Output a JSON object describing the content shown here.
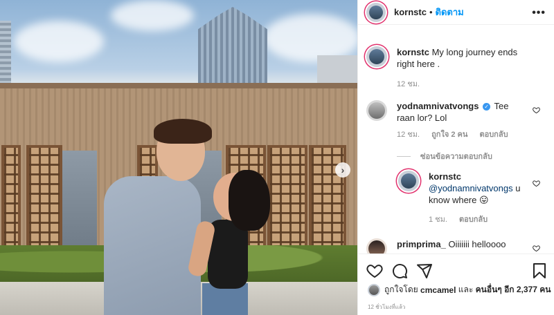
{
  "post": {
    "username": "kornstc",
    "separator": "•",
    "follow_label": "ติดตาม",
    "more_icon": "more-dots-icon"
  },
  "caption": {
    "username": "kornstc",
    "text": "My long journey ends right here .",
    "time": "12 ชม."
  },
  "comments": [
    {
      "username": "yodnamnivatvongs",
      "verified": true,
      "text": "Tee raan lor? Lol",
      "time": "12 ชม.",
      "likes": "ถูกใจ 2 คน",
      "reply_label": "ตอบกลับ",
      "hide_replies_label": "ซ่อนข้อความตอบกลับ",
      "replies": [
        {
          "username": "kornstc",
          "mention": "@yodnamnivatvongs",
          "text": "u know where",
          "emoji": "😛",
          "time": "1 ชม.",
          "reply_label": "ตอบกลับ"
        }
      ]
    },
    {
      "username": "primprima_",
      "text": "Oiiiiiii helloooo"
    }
  ],
  "likes_bar": {
    "liked_by_prefix": "ถูกใจโดย",
    "liked_by_user": "cmcamel",
    "and": "และ",
    "others": "คนอื่นๆ อีก 2,377 คน"
  },
  "posted_ago": "12 ชั่วโมงที่แล้ว",
  "colors": {
    "follow_blue": "#0095f6",
    "story_ring": "#e1306c"
  }
}
